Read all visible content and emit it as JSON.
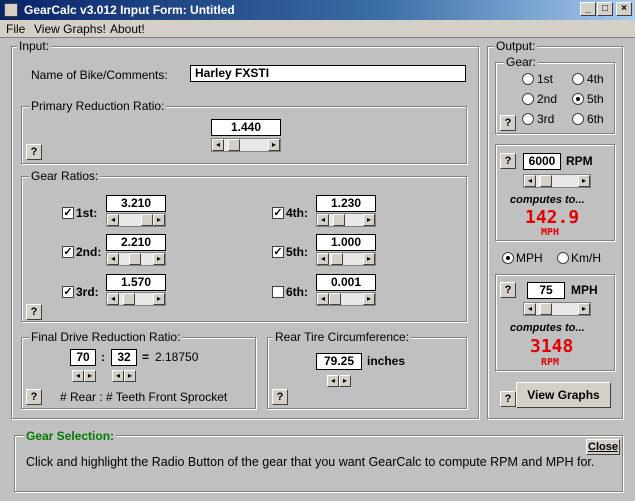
{
  "window": {
    "title": "GearCalc v3.012 Input Form: Untitled",
    "min": "_",
    "max": "□",
    "close": "×"
  },
  "menu": {
    "file": "File",
    "view_graphs": "View Graphs!",
    "about": "About!"
  },
  "input": {
    "group_label": "Input:",
    "name_label": "Name of Bike/Comments:",
    "name_value": "Harley FXSTI",
    "primary": {
      "label": "Primary Reduction Ratio:",
      "value": "1.440",
      "slider": 0.2
    },
    "gear_ratios": {
      "label": "Gear Ratios:",
      "gears": [
        {
          "label": "1st:",
          "value": "3.210",
          "checked": true,
          "slider": 0.7
        },
        {
          "label": "2nd:",
          "value": "2.210",
          "checked": true,
          "slider": 0.45
        },
        {
          "label": "3rd:",
          "value": "1.570",
          "checked": true,
          "slider": 0.3
        },
        {
          "label": "4th:",
          "value": "1.230",
          "checked": true,
          "slider": 0.25
        },
        {
          "label": "5th:",
          "value": "1.000",
          "checked": true,
          "slider": 0.2
        },
        {
          "label": "6th:",
          "value": "0.001",
          "checked": false,
          "slider": 0.0
        }
      ]
    },
    "final_drive": {
      "label": "Final Drive Reduction Ratio:",
      "rear": "70",
      "colon": ":",
      "front": "32",
      "equals": "=",
      "ratio": "2.18750",
      "caption": "# Rear : # Teeth Front Sprocket"
    },
    "tire": {
      "label": "Rear Tire Circumference:",
      "value": "79.25",
      "unit": "inches"
    }
  },
  "output": {
    "group_label": "Output:",
    "gear": {
      "label": "Gear:",
      "options": [
        {
          "label": "1st",
          "selected": false
        },
        {
          "label": "4th",
          "selected": false
        },
        {
          "label": "2nd",
          "selected": false
        },
        {
          "label": "5th",
          "selected": true
        },
        {
          "label": "3rd",
          "selected": false
        },
        {
          "label": "6th",
          "selected": false
        }
      ]
    },
    "rpm_box": {
      "value": "6000",
      "unit": "RPM",
      "computes": "computes to...",
      "result": "142.9",
      "result_unit": "MPH",
      "slider": 0.3
    },
    "units": {
      "mph": "MPH",
      "kmh": "Km/H",
      "selected": "MPH"
    },
    "speed_box": {
      "value": "75",
      "unit": "MPH",
      "computes": "computes to...",
      "result": "3148",
      "result_unit": "RPM",
      "slider": 0.3
    },
    "view_graphs_button": "View Graphs"
  },
  "help": "?",
  "gear_selection": {
    "label": "Gear Selection:",
    "close": "Close",
    "text": "Click and highlight the Radio Button of the gear that you want GearCalc to compute RPM and MPH for."
  },
  "colors": {
    "title_start": "#0a246a",
    "result_red": "#e00000",
    "panel_label_green": "#007a00"
  }
}
